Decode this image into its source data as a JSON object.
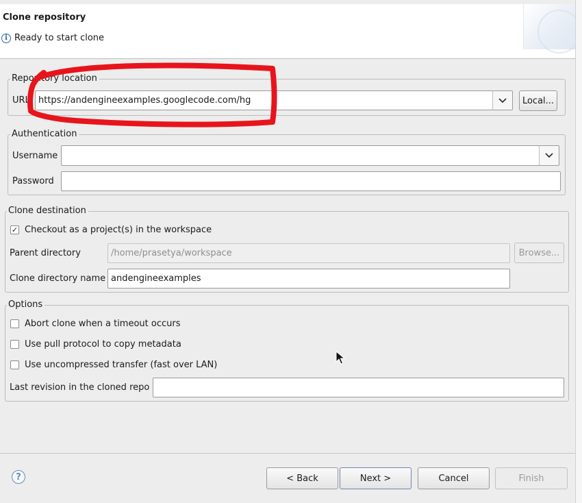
{
  "header": {
    "title": "Clone repository",
    "message": "Ready to start clone",
    "info_icon": "i"
  },
  "repository": {
    "group_label": "Repository location",
    "url_label": "URL",
    "url_value": "https://andengineexamples.googlecode.com/hg",
    "local_button": "Local..."
  },
  "authentication": {
    "group_label": "Authentication",
    "username_label": "Username",
    "username_value": "",
    "password_label": "Password",
    "password_value": ""
  },
  "clone_destination": {
    "group_label": "Clone destination",
    "checkout_label": "Checkout as a project(s) in the workspace",
    "checkout_checked": true,
    "parent_dir_label": "Parent directory",
    "parent_dir_value": "/home/prasetya/workspace",
    "browse_button": "Browse...",
    "clone_dir_label": "Clone directory name",
    "clone_dir_value": "andengineexamples"
  },
  "options": {
    "group_label": "Options",
    "abort_label": "Abort clone when a timeout occurs",
    "pull_label": "Use pull protocol to copy metadata",
    "uncompressed_label": "Use uncompressed transfer (fast over LAN)",
    "last_revision_label": "Last revision in the cloned repo",
    "last_revision_value": ""
  },
  "footer": {
    "help_icon": "?",
    "back_button": "< Back",
    "next_button": "Next >",
    "cancel_button": "Cancel",
    "finish_button": "Finish"
  },
  "icons": {
    "chevron": "chevron-down-icon",
    "check": "✓"
  },
  "colors": {
    "annotation_red": "#e8141c",
    "info_blue": "#2b5fa8"
  }
}
